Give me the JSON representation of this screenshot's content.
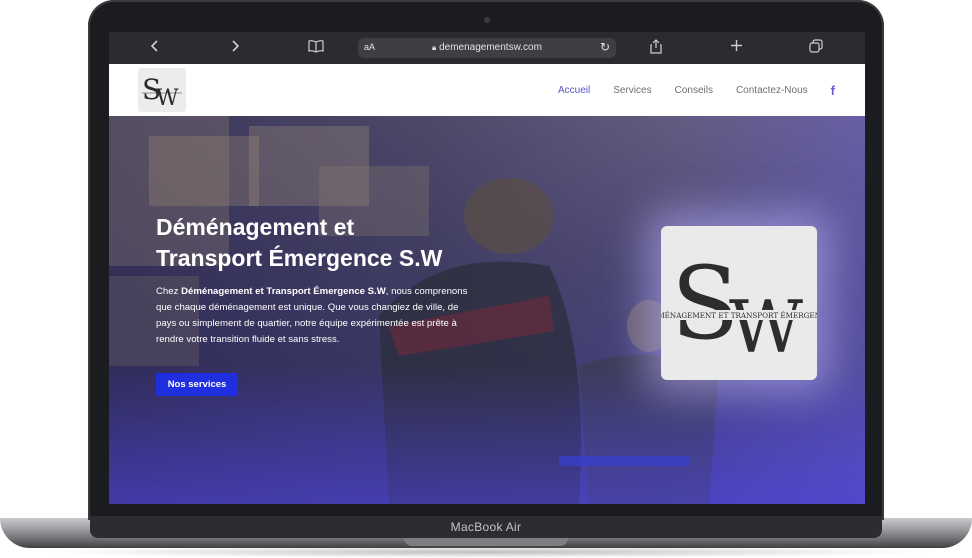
{
  "device": {
    "label": "MacBook Air"
  },
  "browser": {
    "text_size_label": "aA",
    "url": "demenagementsw.com",
    "back_icon": "chevron-left-icon",
    "forward_icon": "chevron-right-icon",
    "bookmarks_icon": "book-icon",
    "reload_icon": "reload-icon",
    "share_icon": "share-icon",
    "new_tab_icon": "plus-icon",
    "tabs_icon": "tabs-icon"
  },
  "site": {
    "logo": {
      "letters": "SW",
      "tagline": "DÉMÉNAGEMENT ET TRANSPORT ÉMERGENCE"
    },
    "nav": {
      "items": [
        {
          "label": "Accueil",
          "active": true
        },
        {
          "label": "Services",
          "active": false
        },
        {
          "label": "Conseils",
          "active": false
        },
        {
          "label": "Contactez-Nous",
          "active": false
        }
      ],
      "facebook_label": "f"
    },
    "hero": {
      "title_line1": "Déménagement et",
      "title_line2": "Transport Émergence S.W",
      "text_prefix": "Chez ",
      "text_bold": "Déménagement et Transport Émergence S.W",
      "text_rest": ", nous comprenons que chaque déménagement est unique. Que vous changiez de ville, de pays ou simplement de quartier, notre équipe expérimentée est prête à rendre votre transition fluide et sans stress.",
      "cta_label": "Nos services"
    }
  },
  "colors": {
    "accent": "#1f2fe0",
    "nav_active": "#5b57c9",
    "facebook": "#6a5cd8"
  }
}
